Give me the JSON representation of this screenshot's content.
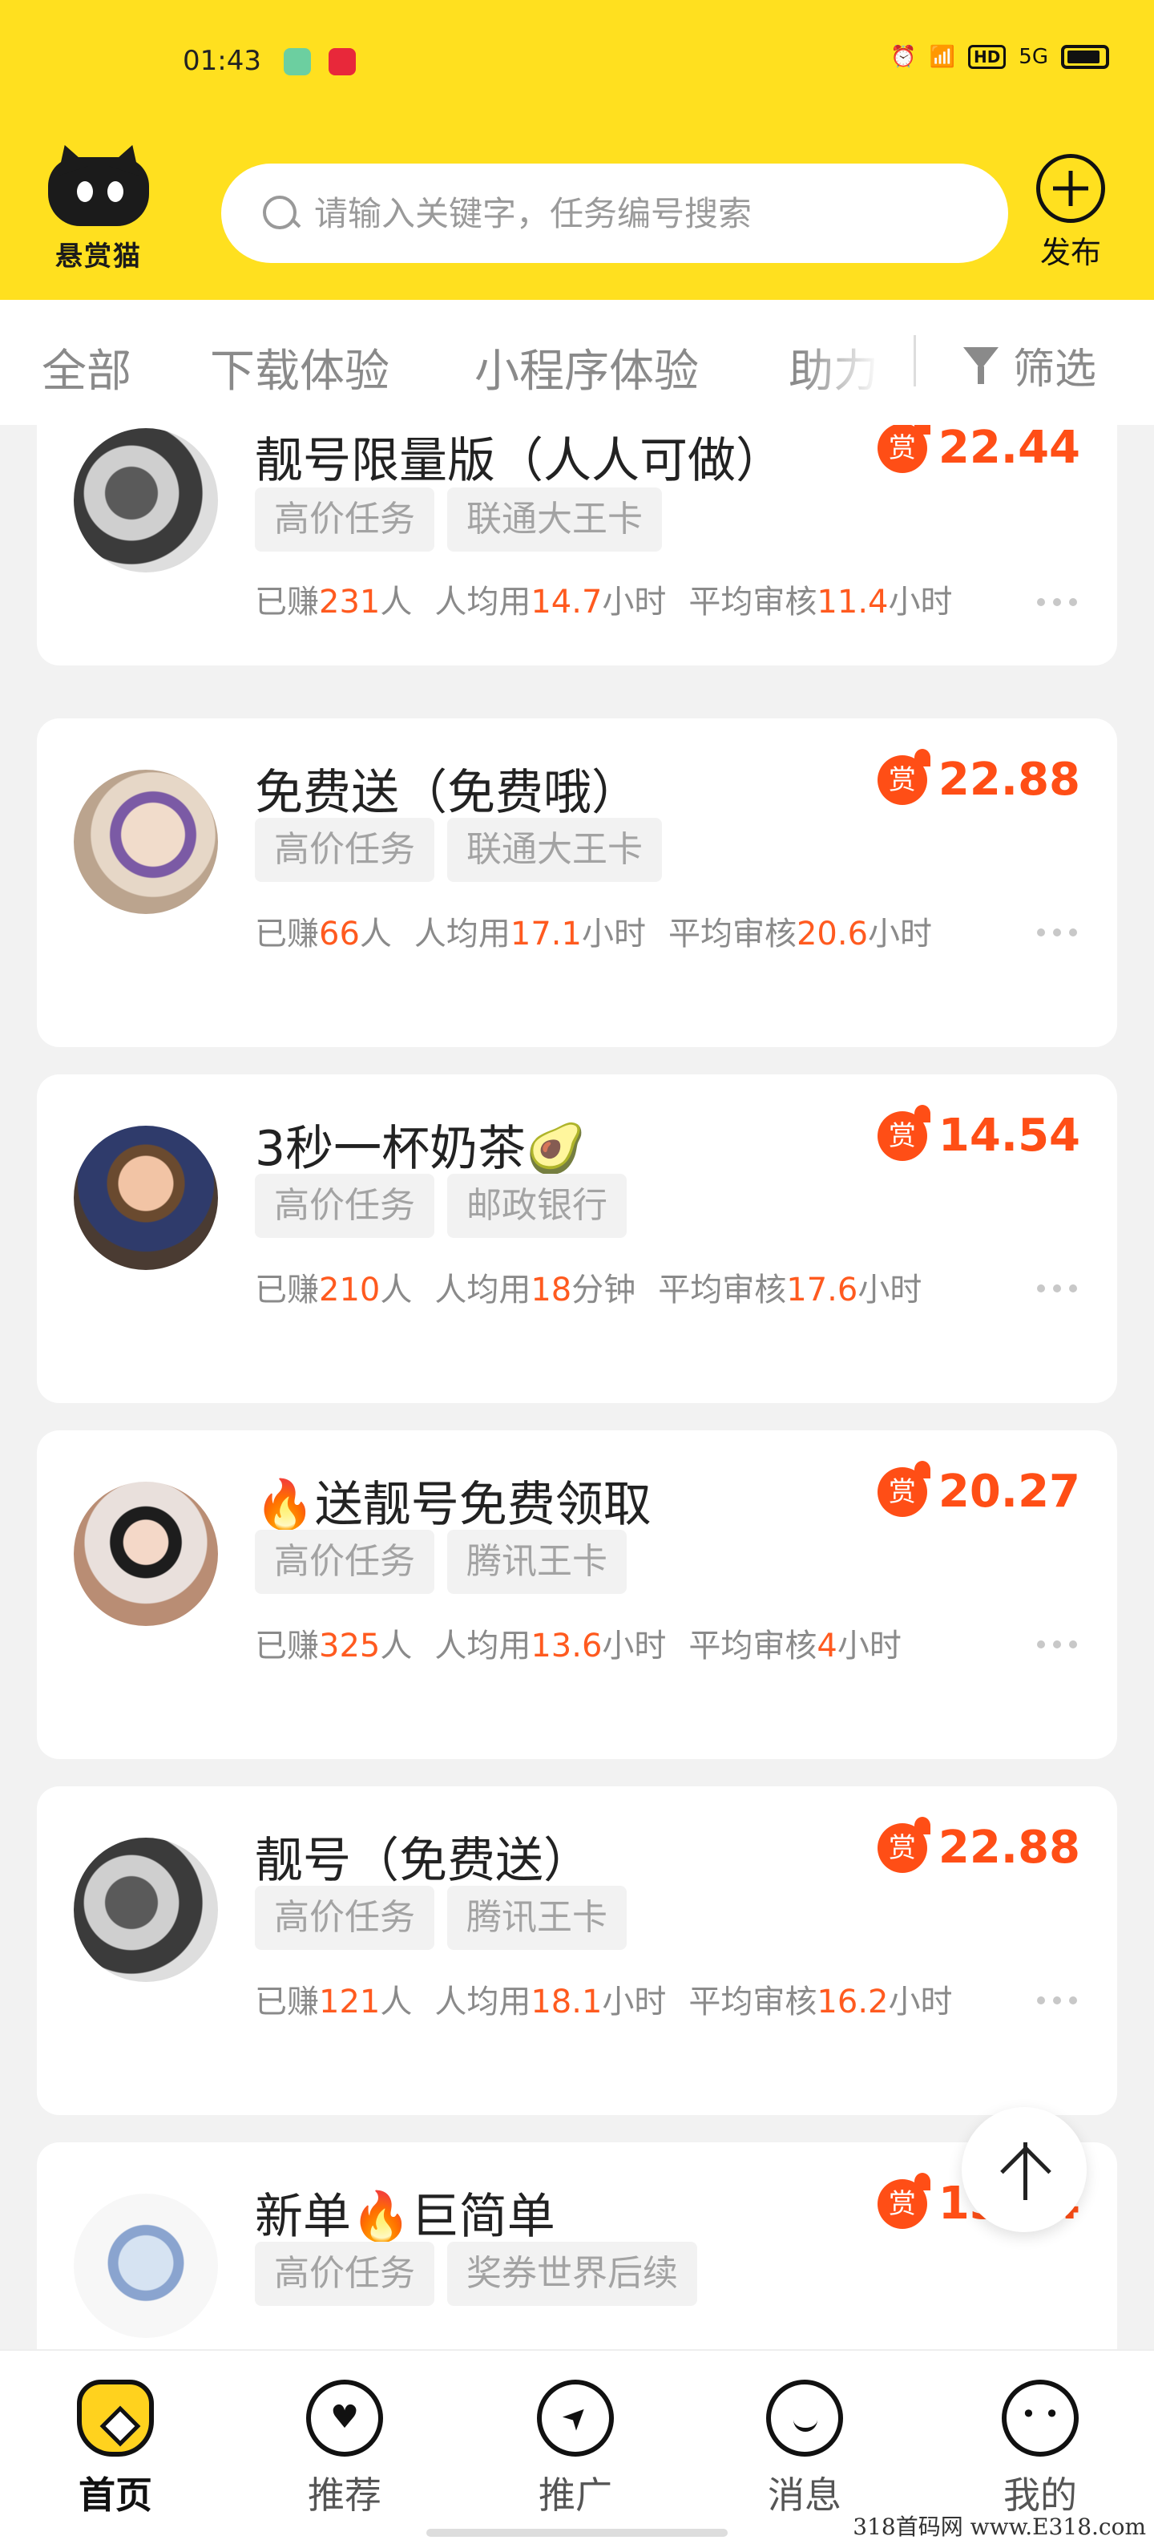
{
  "status": {
    "time": "01:43",
    "hd": "HD",
    "net": "5G"
  },
  "app": {
    "logo_text": "悬赏猫",
    "search_placeholder": "请输入关键字，任务编号搜索",
    "publish_label": "发布"
  },
  "tabs": [
    {
      "label": "全部"
    },
    {
      "label": "下载体验"
    },
    {
      "label": "小程序体验"
    },
    {
      "label": "助力"
    }
  ],
  "filter_label": "筛选",
  "reward_badge": "赏",
  "stats_labels": {
    "earned_prefix": "已赚",
    "earned_suffix": "人",
    "avg_time": "人均用",
    "avg_review": "平均审核",
    "hours": "小时",
    "minutes": "分钟"
  },
  "tasks": [
    {
      "title": "靓号限量版（人人可做）",
      "reward": "22.44",
      "tags": [
        "高价任务",
        "联通大王卡"
      ],
      "earned": "231",
      "avg": "14.7",
      "avg_unit": "小时",
      "review": "11.4"
    },
    {
      "title": "免费送（免费哦）",
      "reward": "22.88",
      "tags": [
        "高价任务",
        "联通大王卡"
      ],
      "earned": "66",
      "avg": "17.1",
      "avg_unit": "小时",
      "review": "20.6"
    },
    {
      "title": "3秒一杯奶茶🥑",
      "reward": "14.54",
      "tags": [
        "高价任务",
        "邮政银行"
      ],
      "earned": "210",
      "avg": "18",
      "avg_unit": "分钟",
      "review": "17.6"
    },
    {
      "title": "🔥送靓号免费领取",
      "reward": "20.27",
      "tags": [
        "高价任务",
        "腾讯王卡"
      ],
      "earned": "325",
      "avg": "13.6",
      "avg_unit": "小时",
      "review": "4"
    },
    {
      "title": "靓号（免费送）",
      "reward": "22.88",
      "tags": [
        "高价任务",
        "腾讯王卡"
      ],
      "earned": "121",
      "avg": "18.1",
      "avg_unit": "小时",
      "review": "16.2"
    },
    {
      "title": "新单🔥巨简单",
      "reward": "13.64",
      "tags": [
        "高价任务",
        "奖券世界后续"
      ],
      "earned": "",
      "avg": "",
      "avg_unit": "",
      "review": ""
    }
  ],
  "bottom_nav": [
    {
      "label": "首页",
      "active": true
    },
    {
      "label": "推荐"
    },
    {
      "label": "推广"
    },
    {
      "label": "消息"
    },
    {
      "label": "我的"
    }
  ],
  "watermark": "318首码网  www.E318.com"
}
